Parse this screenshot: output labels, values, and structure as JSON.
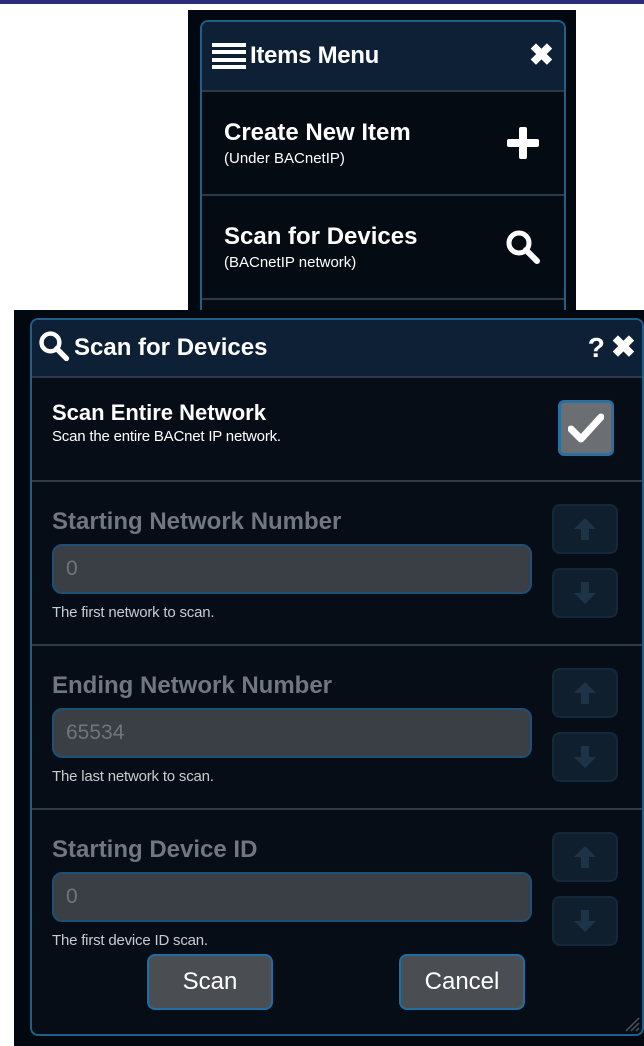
{
  "items_menu": {
    "title": "Items Menu",
    "items": [
      {
        "label": "Create New Item",
        "sub": "(Under BACnetIP)",
        "icon": "plus-icon"
      },
      {
        "label": "Scan for Devices",
        "sub": "(BACnetIP network)",
        "icon": "search-icon"
      }
    ]
  },
  "dialog": {
    "title": "Scan for Devices",
    "help": "?",
    "scan_entire": {
      "label": "Scan Entire Network",
      "description": "Scan the entire BACnet IP network.",
      "checked": true
    },
    "fields": [
      {
        "label": "Starting Network Number",
        "value": "0",
        "hint": "The first network to scan."
      },
      {
        "label": "Ending Network Number",
        "value": "65534",
        "hint": "The last network to scan."
      },
      {
        "label": "Starting Device ID",
        "value": "0",
        "hint": "The first device ID scan."
      }
    ],
    "buttons": {
      "scan": "Scan",
      "cancel": "Cancel"
    }
  },
  "colors": {
    "panel_bg": "#070d16",
    "header_bg": "#0e2036",
    "accent_border": "#1f5f8a",
    "disabled_text": "#6f7780"
  }
}
